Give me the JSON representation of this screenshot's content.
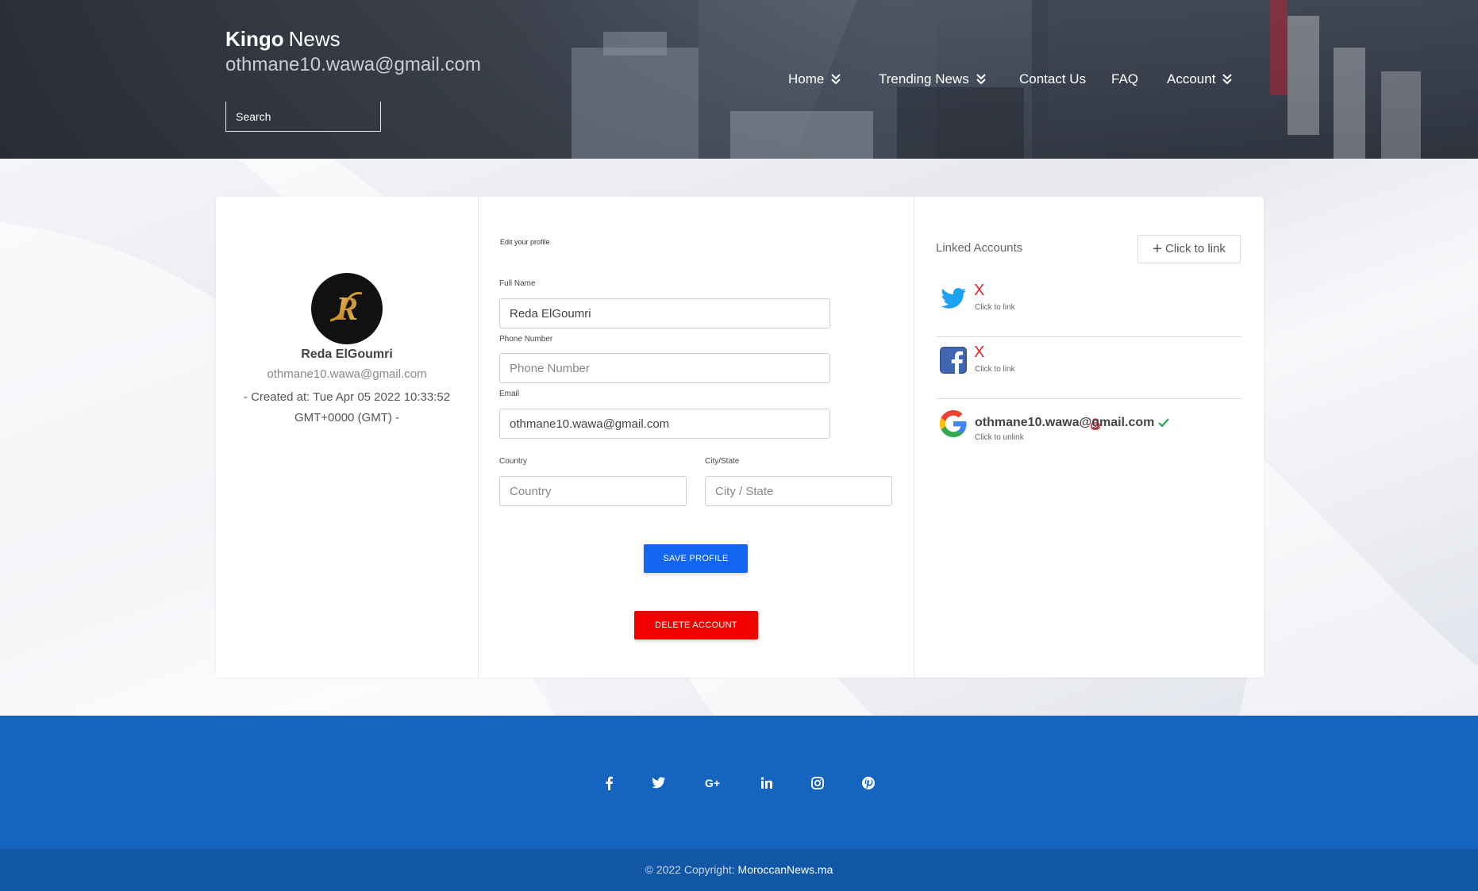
{
  "header": {
    "brand_bold": "Kingo",
    "brand_regular": "News",
    "user_email": "othmane10.wawa@gmail.com",
    "search_placeholder": "Search"
  },
  "nav": {
    "items": [
      {
        "label": "Home",
        "has_dropdown": true
      },
      {
        "label": "Trending News",
        "has_dropdown": true
      },
      {
        "label": "Contact Us",
        "has_dropdown": false
      },
      {
        "label": "FAQ",
        "has_dropdown": false
      },
      {
        "label": "Account",
        "has_dropdown": true
      }
    ]
  },
  "profile": {
    "name": "Reda ElGoumri",
    "email": "othmane10.wawa@gmail.com",
    "created": "- Created at: Tue Apr 05 2022 10:33:52 GMT+0000 (GMT) -",
    "avatar_letter": "R"
  },
  "form": {
    "title": "Edit your profile",
    "full_name_label": "Full Name",
    "full_name_value": "Reda ElGoumri",
    "phone_label": "Phone Number",
    "phone_placeholder": "Phone Number",
    "email_label": "Email",
    "email_value": "othmane10.wawa@gmail.com",
    "country_label": "Country",
    "country_placeholder": "Country",
    "city_label": "City/State",
    "city_placeholder": "City / State",
    "save_label": "SAVE PROFILE",
    "delete_label": "DELETE ACCOUNT"
  },
  "linked": {
    "title": "Linked Accounts",
    "link_button": "Click to link",
    "accounts": [
      {
        "provider": "twitter",
        "linked": false,
        "status_mark": "X",
        "action": "Click to link"
      },
      {
        "provider": "facebook",
        "linked": false,
        "status_mark": "X",
        "action": "Click to link"
      },
      {
        "provider": "google",
        "linked": true,
        "account": "othmane10.wawa@gmail.com",
        "action": "Click to unlink"
      }
    ]
  },
  "footer": {
    "social_icons": [
      "facebook-icon",
      "twitter-icon",
      "google-plus-icon",
      "linkedin-icon",
      "instagram-icon",
      "pinterest-icon"
    ],
    "copyright": "© 2022 Copyright:",
    "copyright_link": "MoroccanNews.ma"
  },
  "colors": {
    "primary": "#1266f1",
    "danger": "#f10000",
    "footer_blue": "#1565c0",
    "footer_dark": "#1257a5",
    "unlinked_x": "#e3232f",
    "linked_check": "#1aaa55"
  }
}
